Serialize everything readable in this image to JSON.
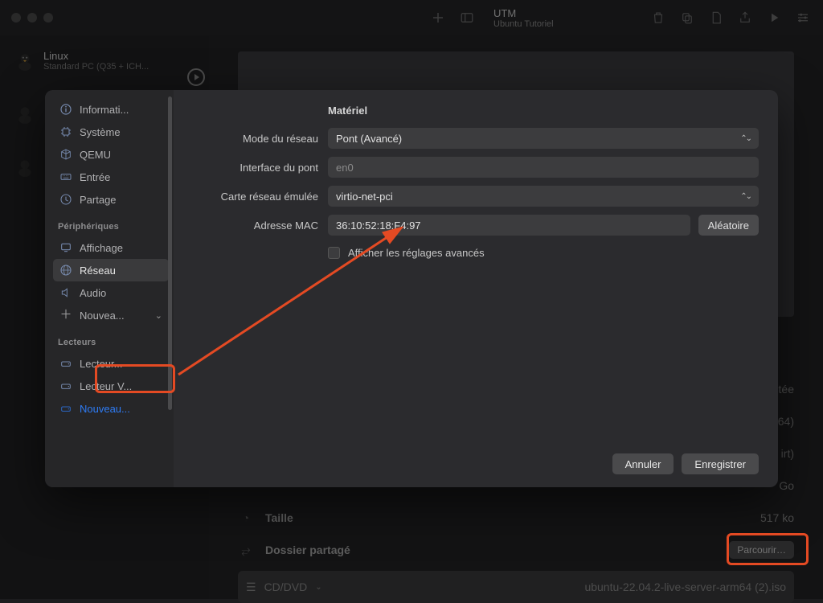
{
  "window": {
    "title": "UTM",
    "subtitle": "Ubuntu Tutoriel"
  },
  "bg_sidebar": {
    "vm_name": "Linux",
    "vm_sub": "Standard PC (Q35 + ICH..."
  },
  "bg_details": {
    "size_label": "Taille",
    "size_value": "517 ko",
    "arm_value": "64)",
    "irt_value": "irt)",
    "go_value": "Go",
    "tee_value": "tée",
    "shared_label": "Dossier partagé",
    "browse_label": "Parcourir…",
    "cd_label": "CD/DVD",
    "iso_name": "ubuntu-22.04.2-live-server-arm64 (2).iso"
  },
  "sheet": {
    "sidebar": {
      "items_top": [
        {
          "icon": "info-icon",
          "label": "Informati..."
        },
        {
          "icon": "chip-icon",
          "label": "Système"
        },
        {
          "icon": "cube-icon",
          "label": "QEMU"
        },
        {
          "icon": "keyboard-icon",
          "label": "Entrée"
        },
        {
          "icon": "share-icon",
          "label": "Partage"
        }
      ],
      "section_peripherals": "Périphériques",
      "items_periph": [
        {
          "icon": "display-icon",
          "label": "Affichage"
        },
        {
          "icon": "globe-icon",
          "label": "Réseau",
          "selected": true
        },
        {
          "icon": "speaker-icon",
          "label": "Audio"
        },
        {
          "icon": "plus-icon",
          "label": "Nouvea...",
          "chevron": true
        }
      ],
      "section_drives": "Lecteurs",
      "items_drives": [
        {
          "icon": "drive-icon",
          "label": "Lecteur..."
        },
        {
          "icon": "drive-icon",
          "label": "Lecteur V..."
        },
        {
          "icon": "drive-icon",
          "label": "Nouveau...",
          "link": true
        }
      ]
    },
    "content": {
      "section_title": "Matériel",
      "rows": {
        "mode": {
          "label": "Mode du réseau",
          "value": "Pont (Avancé)"
        },
        "iface": {
          "label": "Interface du pont",
          "value": "en0"
        },
        "card": {
          "label": "Carte réseau émulée",
          "value": "virtio-net-pci"
        },
        "mac": {
          "label": "Adresse MAC",
          "value": "36:10:52:18:F4:97",
          "random": "Aléatoire"
        }
      },
      "advanced_label": "Afficher les réglages avancés"
    },
    "footer": {
      "cancel": "Annuler",
      "save": "Enregistrer"
    }
  }
}
